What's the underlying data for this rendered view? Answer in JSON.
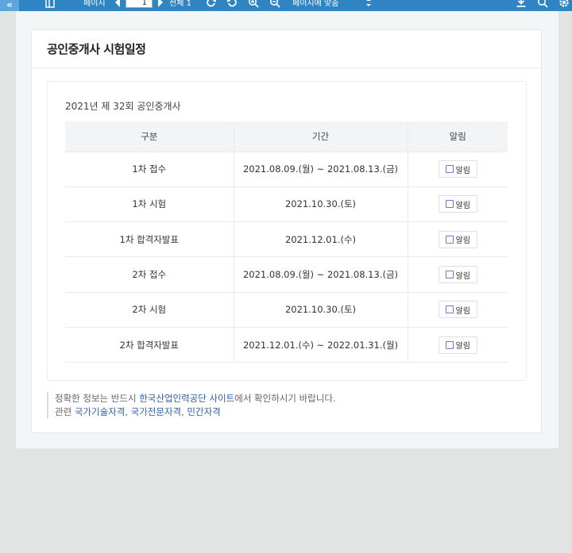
{
  "toolbar": {
    "page_label": "페이지",
    "page_current": "1",
    "page_total": "전체 1",
    "zoom_select": "페이지에 맞춤",
    "icons": [
      "collapse-icon",
      "sidebar-icon",
      "prev-page-icon",
      "next-page-icon",
      "rotate-cw-icon",
      "rotate-ccw-icon",
      "zoom-in-icon",
      "zoom-out-icon",
      "dropdown-icon",
      "download-icon",
      "search-icon",
      "settings-icon"
    ]
  },
  "card": {
    "title": "공인중개사 시험일정"
  },
  "exam": {
    "title": "2021년 제 32회 공인중개사",
    "headers": [
      "구분",
      "기간",
      "알림"
    ],
    "alarm_label": "알림",
    "rows": [
      {
        "type": "1차 접수",
        "period": "2021.08.09.(월) ~ 2021.08.13.(금)"
      },
      {
        "type": "1차 시험",
        "period": "2021.10.30.(토)"
      },
      {
        "type": "1차 합격자발표",
        "period": "2021.12.01.(수)"
      },
      {
        "type": "2차 접수",
        "period": "2021.08.09.(월) ~ 2021.08.13.(금)"
      },
      {
        "type": "2차 시험",
        "period": "2021.10.30.(토)"
      },
      {
        "type": "2차 합격자발표",
        "period": "2021.12.01.(수) ~ 2022.01.31.(월)"
      }
    ]
  },
  "notice": {
    "line1_pre": "정확한 정보는 반드시 ",
    "line1_link": "한국산업인력공단 사이트",
    "line1_post": "에서 확인하시기 바랍니다.",
    "line2_pre": "관련 ",
    "link_a": "국가기술자격",
    "sep1": ", ",
    "link_b": "국가전문자격",
    "sep2": ", ",
    "link_c": "민간자격"
  },
  "colors": {
    "toolbar": "#2f84c4",
    "link": "#2e5fa8",
    "alarm_checkbox": "#8b6bd0",
    "background": "#e2e4e4"
  }
}
